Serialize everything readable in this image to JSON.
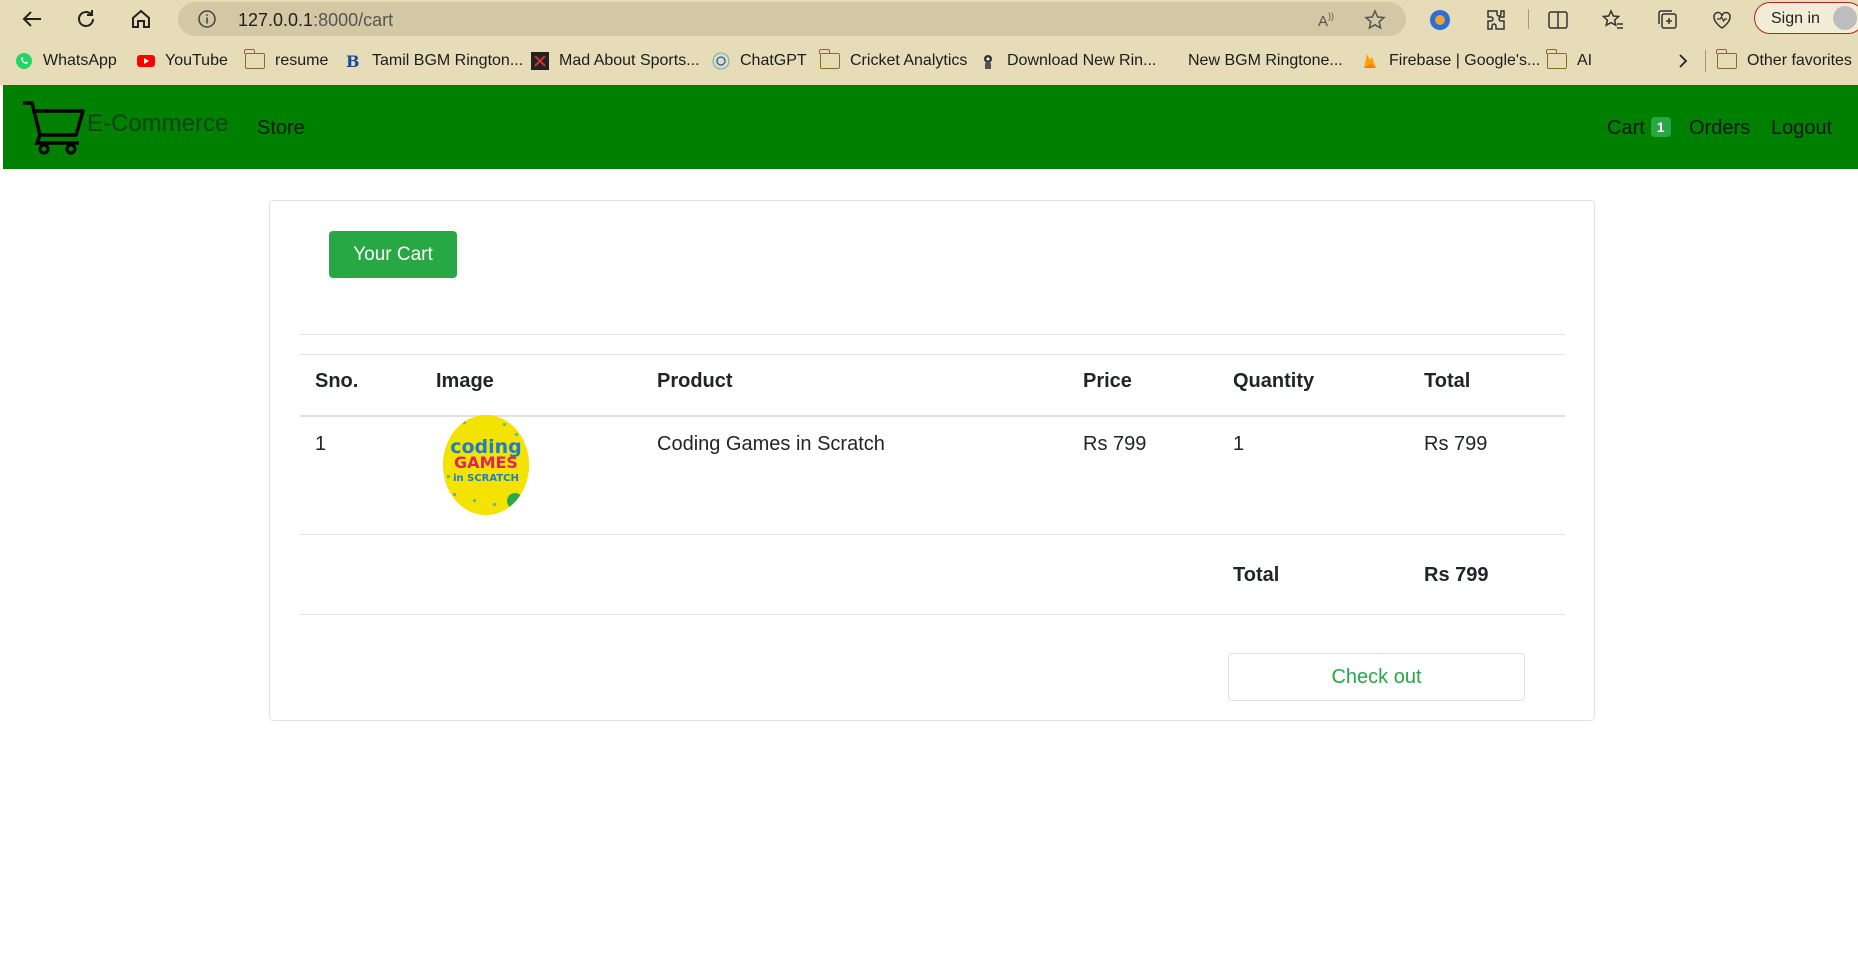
{
  "browser": {
    "url_host": "127.0.0.1",
    "url_path": ":8000/cart",
    "sign_in_label": "Sign in",
    "bookmarks": [
      {
        "label": "WhatsApp",
        "icon": "whatsapp-icon"
      },
      {
        "label": "YouTube",
        "icon": "youtube-icon"
      },
      {
        "label": "resume",
        "icon": "folder-icon"
      },
      {
        "label": "Tamil BGM Rington...",
        "icon": "site-icon"
      },
      {
        "label": "Mad About Sports...",
        "icon": "site-icon"
      },
      {
        "label": "ChatGPT",
        "icon": "chatgpt-icon"
      },
      {
        "label": "Cricket Analytics",
        "icon": "folder-icon"
      },
      {
        "label": "Download New Rin...",
        "icon": "site-icon"
      },
      {
        "label": "New BGM Ringtone...",
        "icon": "site-icon"
      },
      {
        "label": "Firebase | Google's...",
        "icon": "firebase-icon"
      },
      {
        "label": "AI",
        "icon": "folder-icon"
      },
      {
        "label": "Other favorites",
        "icon": "folder-icon"
      }
    ]
  },
  "navbar": {
    "brand": "E-Commerce",
    "store": "Store",
    "cart": "Cart",
    "cart_count": "1",
    "orders": "Orders",
    "logout": "Logout",
    "color": "#008000"
  },
  "cart": {
    "title_button": "Your Cart",
    "headers": {
      "sno": "Sno.",
      "image": "Image",
      "product": "Product",
      "price": "Price",
      "quantity": "Quantity",
      "total": "Total"
    },
    "items": [
      {
        "sno": "1",
        "image_text": [
          "coding",
          "GAMES",
          "in SCRATCH"
        ],
        "product": "Coding Games in Scratch",
        "price": "Rs 799",
        "quantity": "1",
        "total": "Rs 799"
      }
    ],
    "grand_total_label": "Total",
    "grand_total_value": "Rs 799",
    "checkout_label": "Check out",
    "accent": "#28a745"
  }
}
